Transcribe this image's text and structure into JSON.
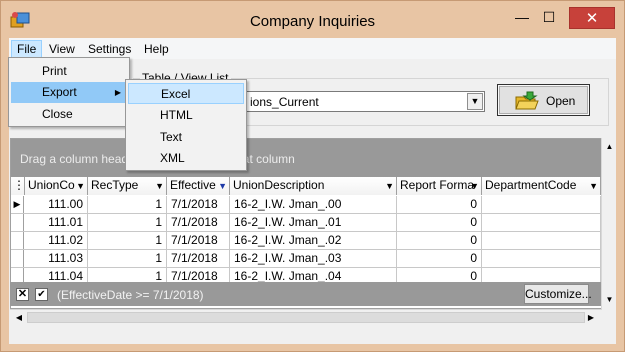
{
  "window": {
    "title": "Company Inquiries",
    "minimize_glyph": "—",
    "maximize_glyph": "☐",
    "close_glyph": "✕"
  },
  "menubar": {
    "file": "File",
    "view": "View",
    "settings": "Settings",
    "help": "Help"
  },
  "file_menu": {
    "print": "Print",
    "export": "Export",
    "close": "Close"
  },
  "export_menu": {
    "excel": "Excel",
    "html": "HTML",
    "text": "Text",
    "xml": "XML"
  },
  "table_view": {
    "group_title": "Table / View List",
    "selected_value": "ions_Current",
    "open_label": "Open"
  },
  "grid": {
    "group_hint": "Drag a column header here to group by that column",
    "columns": [
      "UnionCo",
      "RecType",
      "Effective",
      "UnionDescription",
      "Report Forma",
      "DepartmentCode"
    ],
    "rows": [
      [
        "111.00",
        "1",
        "7/1/2018",
        "16-2_I.W. Jman_.00",
        "0",
        ""
      ],
      [
        "111.01",
        "1",
        "7/1/2018",
        "16-2_I.W. Jman_.01",
        "0",
        ""
      ],
      [
        "111.02",
        "1",
        "7/1/2018",
        "16-2_I.W. Jman_.02",
        "0",
        ""
      ],
      [
        "111.03",
        "1",
        "7/1/2018",
        "16-2_I.W. Jman_.03",
        "0",
        ""
      ],
      [
        "111.04",
        "1",
        "7/1/2018",
        "16-2_I.W. Jman_.04",
        "0",
        ""
      ]
    ]
  },
  "filter": {
    "expression": "(EffectiveDate >= 7/1/2018)",
    "customize_label": "Customize..."
  },
  "colors": {
    "window_frame": "#e8c5a4",
    "close_button": "#c7413a",
    "menu_highlight": "#cce8ff",
    "grid_panel": "#999999"
  }
}
